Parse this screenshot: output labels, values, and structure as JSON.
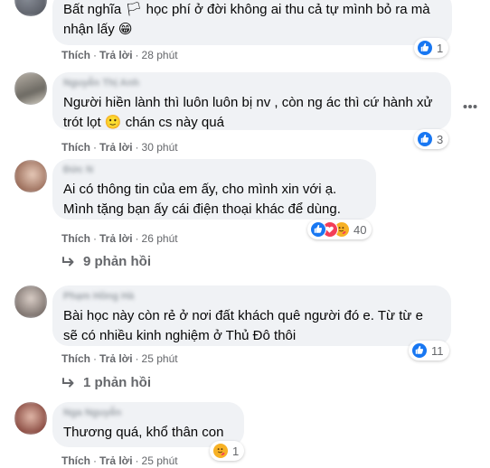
{
  "actions": {
    "like": "Thích",
    "reply": "Trả lời",
    "separator": "·"
  },
  "comments": [
    {
      "author": "",
      "text": "Bất nghĩa 🏳 học phí ở đời không ai thu cả tự mình bỏ ra mà nhận lấy 😁",
      "time": "28 phút",
      "reaction_icons": [
        "like-icon"
      ],
      "reaction_count": "1"
    },
    {
      "author": "Nguyễn Thị Anh",
      "text": "Người hiền lành thì luôn luôn bị nv , còn ng ác thì cứ hành xử trót lọt 🙂 chán cs này quá",
      "time": "30 phút",
      "reaction_icons": [
        "like-icon"
      ],
      "reaction_count": "3"
    },
    {
      "author": "Đức N",
      "text": "Ai có thông tin của em ấy, cho mình xin với ạ.\nMình tặng bạn ấy cái điện thoại khác để dùng.",
      "time": "26 phút",
      "reaction_icons": [
        "like-icon",
        "love-icon",
        "care-icon"
      ],
      "reaction_count": "40",
      "replies": "9 phản hồi"
    },
    {
      "author": "Phạm Hồng Hà",
      "text": "Bài học này còn rẻ ở nơi đất khách quê người đó e. Từ từ e sẽ có nhiều kinh nghiệm ở Thủ Đô thôi",
      "time": "25 phút",
      "reaction_icons": [
        "like-icon"
      ],
      "reaction_count": "11",
      "replies": "1 phản hồi"
    },
    {
      "author": "Nga Nguyễn",
      "text": "Thương quá, khổ thân con",
      "time": "25 phút",
      "reaction_icons": [
        "care-icon"
      ],
      "reaction_count": "1"
    }
  ],
  "colors": {
    "bubble": "#f0f2f5",
    "meta_text": "#65676b",
    "like_blue": "#1877f2",
    "love_red": "#f33e58",
    "care_yellow": "#f7b125"
  },
  "icons": {
    "more": "more-horizontal-icon",
    "reply_arrow": "reply-arrow-icon"
  }
}
